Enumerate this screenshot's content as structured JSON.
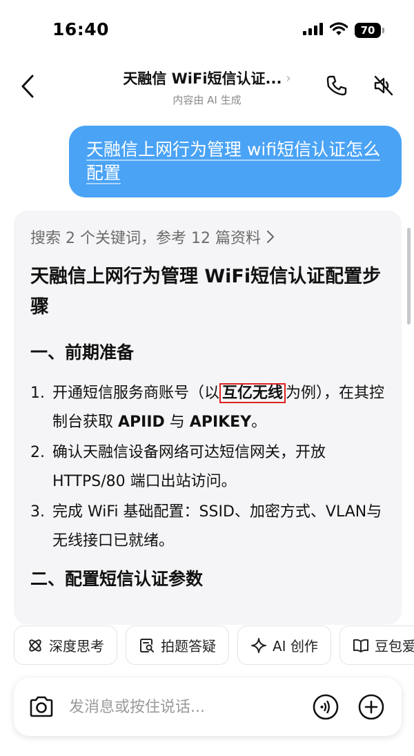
{
  "status_bar": {
    "time": "16:40",
    "battery": "70"
  },
  "header": {
    "title": "天融信 WiFi短信认证...",
    "subtitle": "内容由 AI 生成"
  },
  "user_message": "天融信上网行为管理 wifi短信认证怎么配置",
  "answer": {
    "search_meta": "搜索 2 个关键词，参考 12 篇资料",
    "title": "天融信上网行为管理 WiFi短信认证配置步骤",
    "section1_heading": "一、前期准备",
    "items": [
      {
        "num": "1.",
        "before": "开通短信服务商账号（以",
        "highlight": "互亿无线",
        "middle": "为例），在其控制台获取 ",
        "bold1": "APIID",
        "and": " 与 ",
        "bold2": "APIKEY",
        "end": "。"
      },
      {
        "num": "2.",
        "text": "确认天融信设备网络可达短信网关，开放 HTTPS/80 端口出站访问。"
      },
      {
        "num": "3.",
        "text": "完成 WiFi 基础配置：SSID、加密方式、VLAN与无线接口已就绪。"
      }
    ],
    "section2_heading": "二、配置短信认证参数"
  },
  "chips": [
    {
      "icon": "atom-icon",
      "label": "深度思考"
    },
    {
      "icon": "photo-search-icon",
      "label": "拍题答疑"
    },
    {
      "icon": "sparkle-icon",
      "label": "AI 创作"
    },
    {
      "icon": "book-icon",
      "label": "豆包爱"
    }
  ],
  "input": {
    "placeholder": "发消息或按住说话..."
  },
  "colors": {
    "user_bubble": "#4aa3f5",
    "card_bg": "#f5f5f7",
    "highlight_border": "#e02020"
  }
}
